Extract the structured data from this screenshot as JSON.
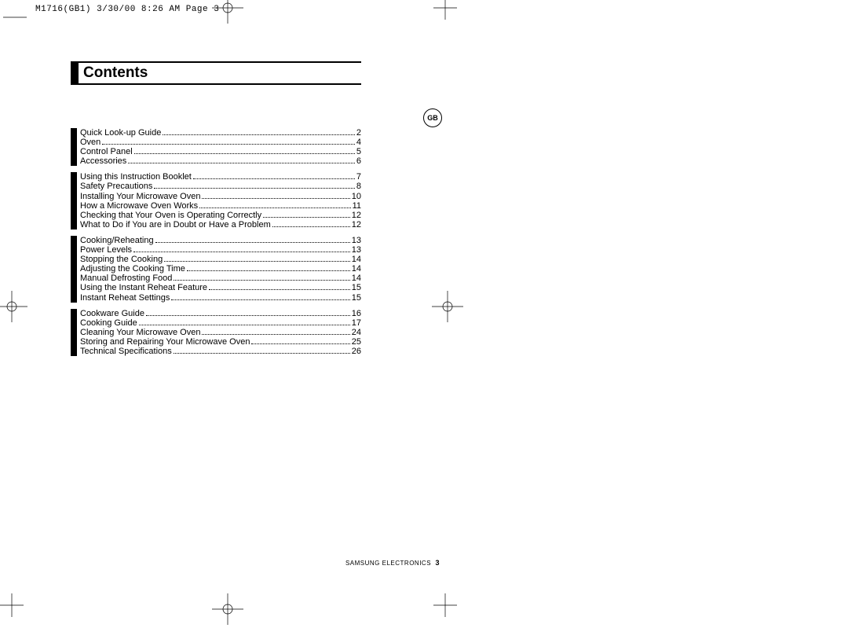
{
  "print_info": "M1716(GB1)  3/30/00 8:26 AM  Page 3",
  "title": "Contents",
  "gb_badge": "GB",
  "footer_company": "SAMSUNG ELECTRONICS",
  "footer_page": "3",
  "groups": [
    [
      {
        "label": "Quick Look-up Guide",
        "pg": "2"
      },
      {
        "label": "Oven",
        "pg": "4"
      },
      {
        "label": "Control Panel",
        "pg": "5"
      },
      {
        "label": "Accessories",
        "pg": "6"
      }
    ],
    [
      {
        "label": "Using this Instruction Booklet",
        "pg": "7"
      },
      {
        "label": "Safety Precautions",
        "pg": "8"
      },
      {
        "label": "Installing Your Microwave Oven",
        "pg": "10"
      },
      {
        "label": "How a Microwave Oven Works",
        "pg": "11"
      },
      {
        "label": "Checking that Your Oven is Operating Correctly",
        "pg": "12"
      },
      {
        "label": "What to Do if You are in Doubt or Have a Problem",
        "pg": "12"
      }
    ],
    [
      {
        "label": "Cooking/Reheating",
        "pg": "13"
      },
      {
        "label": "Power Levels",
        "pg": "13"
      },
      {
        "label": "Stopping the Cooking",
        "pg": "14"
      },
      {
        "label": "Adjusting the Cooking Time",
        "pg": "14"
      },
      {
        "label": "Manual Defrosting Food",
        "pg": "14"
      },
      {
        "label": "Using the Instant Reheat Feature",
        "pg": "15"
      },
      {
        "label": "Instant Reheat Settings",
        "pg": "15"
      }
    ],
    [
      {
        "label": "Cookware Guide",
        "pg": "16"
      },
      {
        "label": "Cooking Guide",
        "pg": "17"
      },
      {
        "label": "Cleaning Your Microwave Oven",
        "pg": "24"
      },
      {
        "label": "Storing and Repairing Your Microwave Oven",
        "pg": "25"
      },
      {
        "label": "Technical Specifications",
        "pg": "26"
      }
    ]
  ]
}
